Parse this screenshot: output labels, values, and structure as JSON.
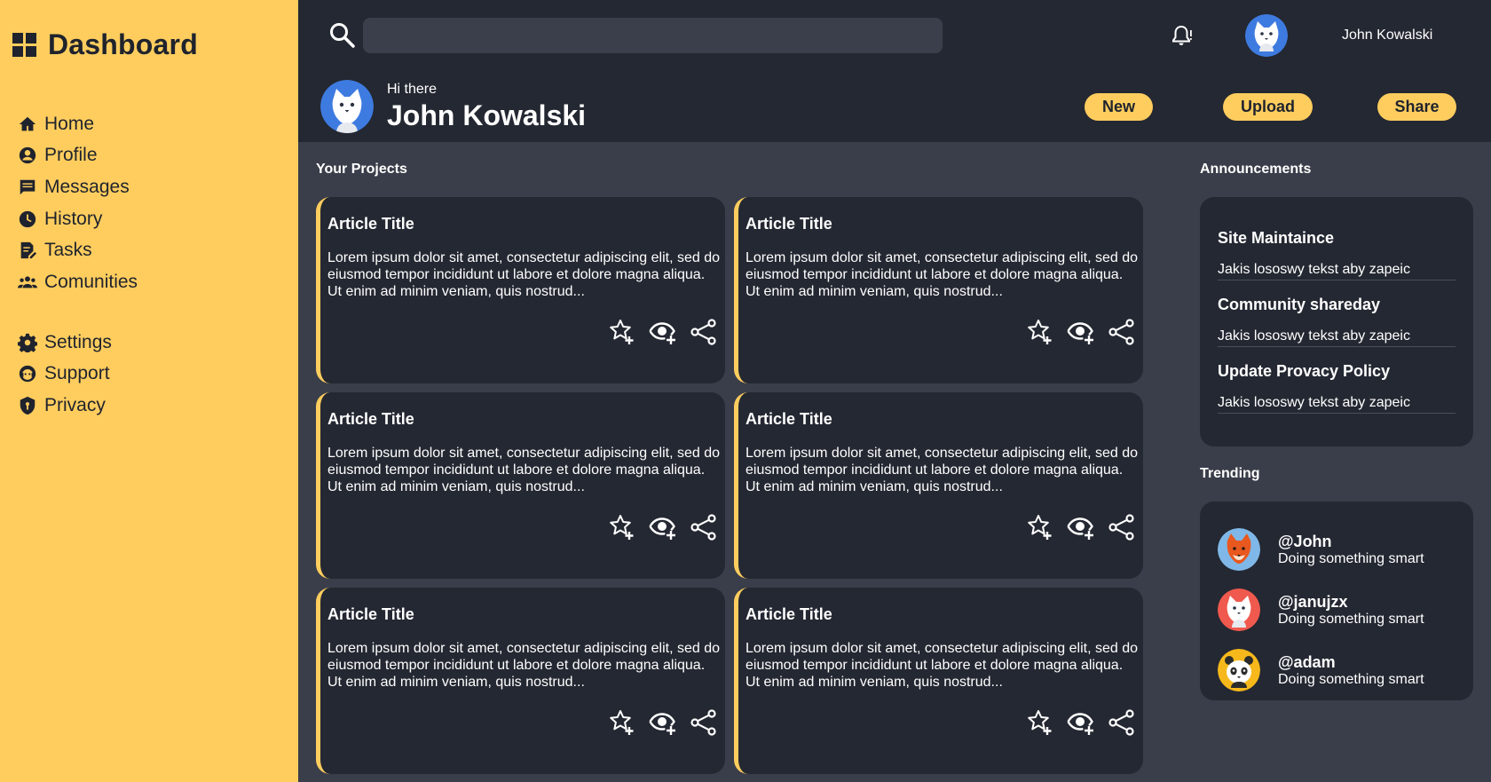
{
  "sidebar": {
    "brand": "Dashboard",
    "primary_items": [
      {
        "label": "Home",
        "icon": "home-icon"
      },
      {
        "label": "Profile",
        "icon": "user-icon"
      },
      {
        "label": "Messages",
        "icon": "message-icon"
      },
      {
        "label": "History",
        "icon": "clock-icon"
      },
      {
        "label": "Tasks",
        "icon": "tasks-icon"
      },
      {
        "label": "Comunities",
        "icon": "group-icon"
      }
    ],
    "secondary_items": [
      {
        "label": "Settings",
        "icon": "gear-icon"
      },
      {
        "label": "Support",
        "icon": "support-icon"
      },
      {
        "label": "Privacy",
        "icon": "shield-icon"
      }
    ]
  },
  "header": {
    "search_placeholder": "",
    "username": "John Kowalski",
    "greeting": "Hi there",
    "display_name": "John Kowalski",
    "actions": {
      "new": "New",
      "upload": "Upload",
      "share": "Share"
    }
  },
  "projects": {
    "title": "Your Projects",
    "cards": [
      {
        "title": "Article Title",
        "text": "Lorem ipsum dolor sit amet, consectetur adipiscing elit, sed do eiusmod tempor incididunt ut labore et dolore magna aliqua. Ut enim ad minim veniam, quis nostrud..."
      },
      {
        "title": "Article Title",
        "text": "Lorem ipsum dolor sit amet, consectetur adipiscing elit, sed do eiusmod tempor incididunt ut labore et dolore magna aliqua. Ut enim ad minim veniam, quis nostrud..."
      },
      {
        "title": "Article Title",
        "text": "Lorem ipsum dolor sit amet, consectetur adipiscing elit, sed do eiusmod tempor incididunt ut labore et dolore magna aliqua. Ut enim ad minim veniam, quis nostrud..."
      },
      {
        "title": "Article Title",
        "text": "Lorem ipsum dolor sit amet, consectetur adipiscing elit, sed do eiusmod tempor incididunt ut labore et dolore magna aliqua. Ut enim ad minim veniam, quis nostrud..."
      },
      {
        "title": "Article Title",
        "text": "Lorem ipsum dolor sit amet, consectetur adipiscing elit, sed do eiusmod tempor incididunt ut labore et dolore magna aliqua. Ut enim ad minim veniam, quis nostrud..."
      },
      {
        "title": "Article Title",
        "text": "Lorem ipsum dolor sit amet, consectetur adipiscing elit, sed do eiusmod tempor incididunt ut labore et dolore magna aliqua. Ut enim ad minim veniam, quis nostrud..."
      }
    ]
  },
  "announcements": {
    "title": "Announcements",
    "items": [
      {
        "title": "Site Maintaince",
        "text": "Jakis lososwy tekst aby zapeic"
      },
      {
        "title": "Community shareday",
        "text": "Jakis lososwy tekst aby zapeic"
      },
      {
        "title": "Update Provacy Policy",
        "text": "Jakis lososwy tekst aby zapeic"
      }
    ]
  },
  "trending": {
    "title": "Trending",
    "items": [
      {
        "handle": "@John",
        "desc": "Doing something smart",
        "avatar_color": "#7fb8e8"
      },
      {
        "handle": "@janujzx",
        "desc": "Doing something smart",
        "avatar_color": "#f0594d"
      },
      {
        "handle": "@adam",
        "desc": "Doing something smart",
        "avatar_color": "#f6b81b"
      }
    ]
  },
  "colors": {
    "accent": "#ffcd5e",
    "panel": "#242832",
    "background": "#3a3e4a"
  }
}
